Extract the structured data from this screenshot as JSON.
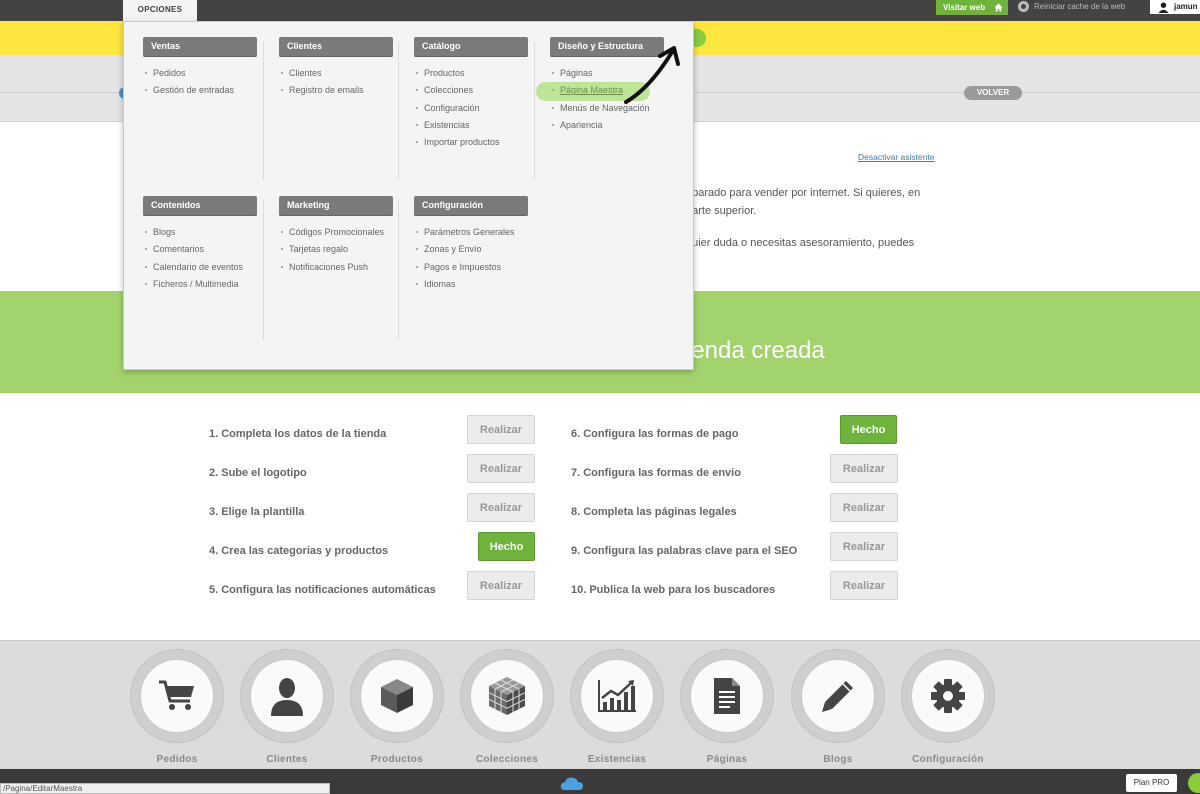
{
  "topbar": {
    "opciones": "OPCIONES",
    "visitar_web": "Visitar web",
    "reiniciar": "Reiniciar cache de la web",
    "user": "jamun"
  },
  "header": {
    "volver": "VOLVER"
  },
  "content": {
    "desactivar": "Desactivar asistente",
    "intro_line1": "eparado para vender por internet. Si quieres, en",
    "intro_line2": "parte superior.",
    "intro_line3": "quier duda o necesitas asesoramiento, puedes",
    "banner_title": "ienda creada"
  },
  "menu": {
    "row1": [
      {
        "title": "Ventas",
        "items": [
          "Pedidos",
          "Gestión de entradas"
        ]
      },
      {
        "title": "Clientes",
        "items": [
          "Clientes",
          "Registro de emails"
        ]
      },
      {
        "title": "Catálogo",
        "items": [
          "Productos",
          "Colecciones",
          "Configuración",
          "Existencias",
          "Importar productos"
        ]
      },
      {
        "title": "Diseño y Estructura",
        "items": [
          "Páginas",
          "Página Maestra",
          "Menús de Navegación",
          "Apariencia"
        ]
      }
    ],
    "row2": [
      {
        "title": "Contenidos",
        "items": [
          "Blogs",
          "Comentarios",
          "Calendario de eventos",
          "Ficheros / Multimedia"
        ]
      },
      {
        "title": "Marketing",
        "items": [
          "Códigos Promocionales",
          "Tarjetas regalo",
          "Notificaciones Push"
        ]
      },
      {
        "title": "Configuración",
        "items": [
          "Parámetros Generales",
          "Zonas y Envío",
          "Pagos e Impuestos",
          "Idiomas"
        ]
      }
    ],
    "highlighted_item": "Página Maestra"
  },
  "tasks": {
    "left": [
      {
        "label": "1. Completa los datos de la tienda",
        "button": "Realizar",
        "done": false
      },
      {
        "label": "2. Sube el logotipo",
        "button": "Realizar",
        "done": false
      },
      {
        "label": "3. Elige la plantilla",
        "button": "Realizar",
        "done": false
      },
      {
        "label": "4. Crea las categorias y productos",
        "button": "Hecho",
        "done": true
      },
      {
        "label": "5. Configura las notificaciones automáticas",
        "button": "Realizar",
        "done": false
      }
    ],
    "right": [
      {
        "label": "6. Configura las formas de pago",
        "button": "Hecho",
        "done": true
      },
      {
        "label": "7. Configura las formas de envio",
        "button": "Realizar",
        "done": false
      },
      {
        "label": "8. Completa las páginas legales",
        "button": "Realizar",
        "done": false
      },
      {
        "label": "9. Configura las palabras clave para el SEO",
        "button": "Realizar",
        "done": false
      },
      {
        "label": "10. Publica la web para los buscadores",
        "button": "Realizar",
        "done": false
      }
    ]
  },
  "dock": [
    {
      "label": "Pedidos",
      "icon": "cart-icon"
    },
    {
      "label": "Clientes",
      "icon": "user-icon"
    },
    {
      "label": "Productos",
      "icon": "box-icon"
    },
    {
      "label": "Colecciones",
      "icon": "cube-grid-icon"
    },
    {
      "label": "Existencias",
      "icon": "chart-icon"
    },
    {
      "label": "Páginas",
      "icon": "document-icon"
    },
    {
      "label": "Blogs",
      "icon": "pencil-icon"
    },
    {
      "label": "Configuración",
      "icon": "gear-icon"
    }
  ],
  "footer": {
    "status_url": "/Pagina/EditarMaestra",
    "plan": "Plan PRO"
  },
  "colors": {
    "topbar": "#434343",
    "yellow": "#fde63e",
    "green_band": "#a3d36d",
    "done_button": "#6db33c",
    "menu_header": "#7b7b7b"
  }
}
